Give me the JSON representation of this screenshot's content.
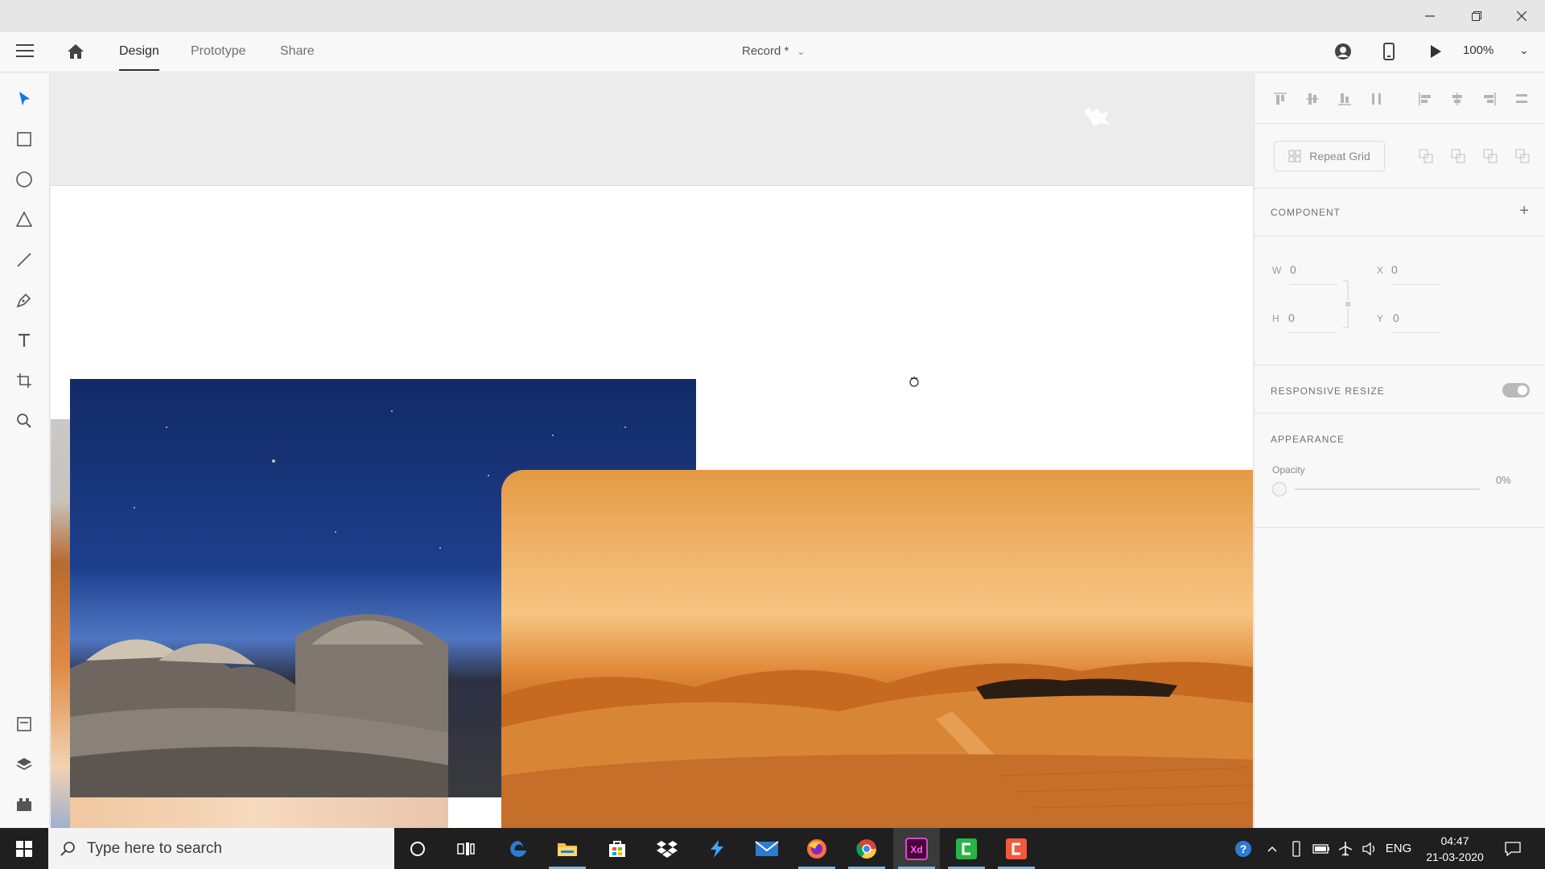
{
  "window": {
    "minimize_icon": "minimize-icon",
    "maximize_icon": "restore-icon",
    "close_icon": "close-icon"
  },
  "header": {
    "tabs": [
      {
        "label": "Design",
        "active": true
      },
      {
        "label": "Prototype",
        "active": false
      },
      {
        "label": "Share",
        "active": false
      }
    ],
    "document_title": "Record *",
    "zoom": "100%"
  },
  "toolbar": {
    "tools": [
      "select-icon",
      "rectangle-icon",
      "ellipse-icon",
      "polygon-icon",
      "line-icon",
      "pen-icon",
      "text-icon",
      "artboard-icon",
      "zoom-icon",
      "assets-icon",
      "layers-icon",
      "plugins-icon"
    ]
  },
  "panel": {
    "repeat_grid_label": "Repeat Grid",
    "component_title": "COMPONENT",
    "w_label": "W",
    "w_value": "0",
    "h_label": "H",
    "h_value": "0",
    "x_label": "X",
    "x_value": "0",
    "y_label": "Y",
    "y_value": "0",
    "responsive_resize_title": "RESPONSIVE RESIZE",
    "responsive_resize_on": true,
    "appearance_title": "APPEARANCE",
    "opacity_label": "Opacity",
    "opacity_value": "0%"
  },
  "taskbar": {
    "search_placeholder": "Type here to search",
    "language": "ENG",
    "time": "04:47",
    "date": "21-03-2020",
    "apps": [
      "cortana-icon",
      "task-view-icon",
      "edge-icon",
      "file-explorer-icon",
      "store-icon",
      "dropbox-icon",
      "visual-studio-icon",
      "mail-icon",
      "firefox-icon",
      "chrome-icon",
      "adobe-xd-icon",
      "camtasia-icon",
      "camtasia-recorder-icon"
    ]
  },
  "colors": {
    "accent_blue": "#2680eb",
    "xd_pink": "#ff61f6",
    "taskbar_bg": "#1f1f1f"
  }
}
